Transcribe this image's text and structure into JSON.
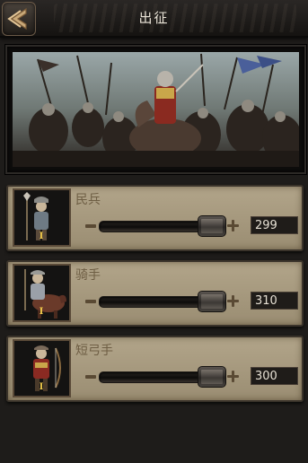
{
  "header": {
    "title": "出征",
    "back_icon": "chevron-left-icon"
  },
  "banner": {
    "icon": "battle-scene-illustration"
  },
  "units": [
    {
      "name": "民兵",
      "tier": "I",
      "quantity": "299",
      "portrait": "militia-spearman-portrait",
      "slider_level": 1.0
    },
    {
      "name": "骑手",
      "tier": "I",
      "quantity": "310",
      "portrait": "rider-horseman-portrait",
      "slider_level": 1.0
    },
    {
      "name": "短弓手",
      "tier": "I",
      "quantity": "300",
      "portrait": "short-bowman-portrait",
      "slider_level": 1.0
    }
  ],
  "colors": {
    "row_parchment": "#a99c80",
    "accent_gold": "#f0c94a",
    "header_bg": "#1c1a18"
  }
}
